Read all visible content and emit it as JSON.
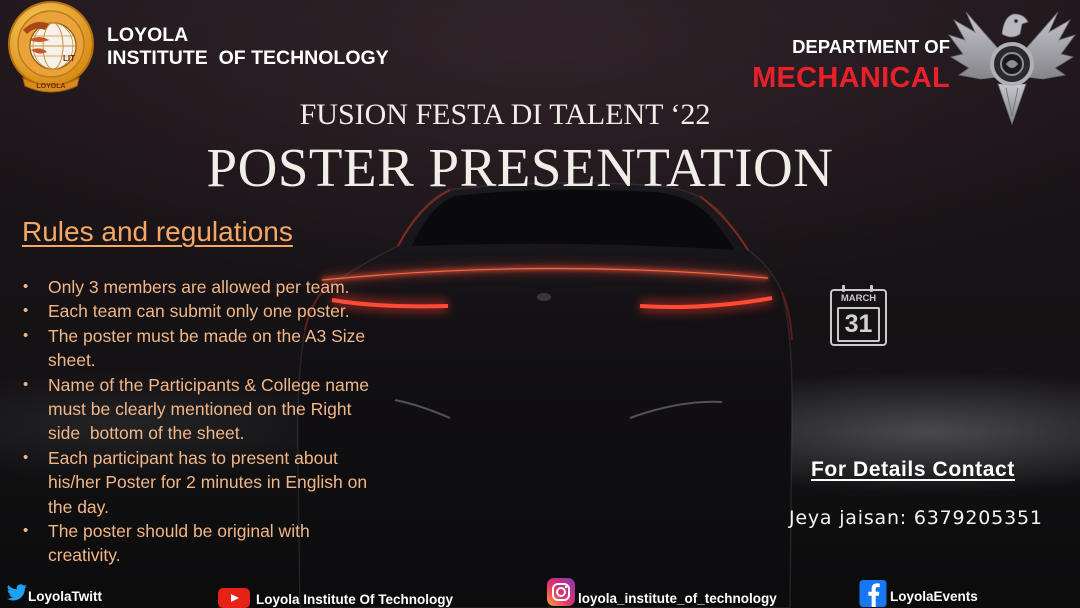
{
  "institute": {
    "name_line1": "LOYOLA",
    "name_line2": "INSTITUTE  OF TECHNOLOGY",
    "logo_lettering": [
      "LIT",
      "LOYOLA"
    ]
  },
  "department": {
    "line1": "DEPARTMENT OF",
    "line2": "MECHANICAL",
    "emblem_icon": "eagle-emblem-icon"
  },
  "event": {
    "subtitle": "FUSION FESTA DI TALENT ‘22",
    "title": "POSTER PRESENTATION"
  },
  "rules": {
    "heading": "Rules and regulations",
    "bullet": "•",
    "items": [
      "Only 3 members are allowed per team.",
      "Each team can submit only one poster.",
      "The poster must be made on the A3 Size sheet.",
      "Name of the Participants & College name must be clearly mentioned on the Right side  bottom of the sheet.",
      "Each participant has to present about his/her Poster for 2 minutes in English on the day.",
      "The poster should be original with creativity."
    ]
  },
  "date": {
    "icon": "calendar-icon",
    "month": "MARCH",
    "day": "31"
  },
  "contact": {
    "heading": "For Details Contact",
    "person": "Jeya jaisan: 6379205351"
  },
  "socials": [
    {
      "icon": "twitter-icon",
      "label": "LoyolaTwitt"
    },
    {
      "icon": "youtube-icon",
      "label": "Loyola Institute Of Technology"
    },
    {
      "icon": "instagram-icon",
      "label": "loyola_institute_of_technology"
    },
    {
      "icon": "facebook-icon",
      "label": "LoyolaEvents"
    }
  ],
  "colors": {
    "rule_text": "#f2b687",
    "rule_heading": "#f5a763",
    "mechanical_red": "#e8202a",
    "title_white": "#f1eee8"
  }
}
